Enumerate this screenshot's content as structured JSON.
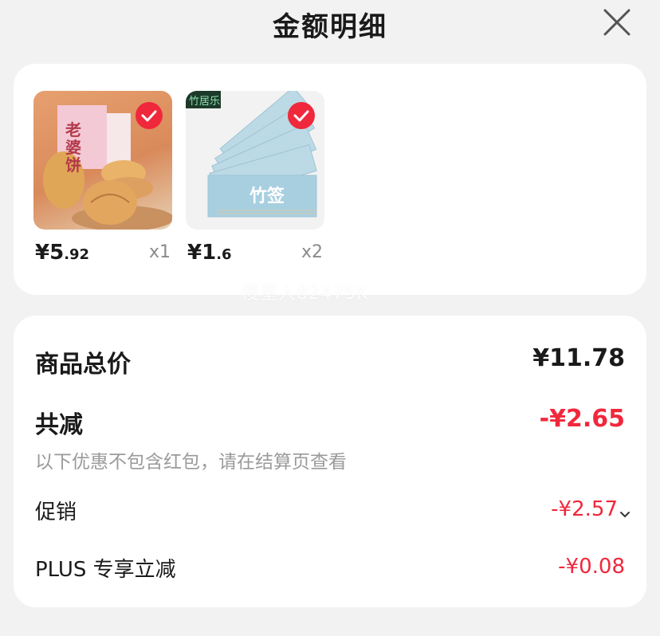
{
  "header": {
    "title": "金额明细"
  },
  "products": [
    {
      "price_main": "¥5",
      "price_decimal": ".92",
      "quantity": "x1",
      "image_text": "老婆饼"
    },
    {
      "price_main": "¥1",
      "price_decimal": ".6",
      "quantity": "x2",
      "image_text": "竹签",
      "brand_text": "竹居乐"
    }
  ],
  "watermark": "慢星人82475K",
  "summary": {
    "total_label": "商品总价",
    "total_value": "¥11.78",
    "discount_label": "共减",
    "discount_value": "-¥2.65",
    "discount_note": "以下优惠不包含红包，请在结算页查看",
    "promo_label": "促销",
    "promo_value": "-¥2.57",
    "plus_label": "PLUS 专享立减",
    "plus_value": "-¥0.08"
  },
  "colors": {
    "accent": "#f0283c",
    "background": "#f2f2f2",
    "card": "#ffffff"
  },
  "icons": {
    "close": "close-icon",
    "check": "check-icon",
    "chevron": "chevron-down-icon"
  }
}
